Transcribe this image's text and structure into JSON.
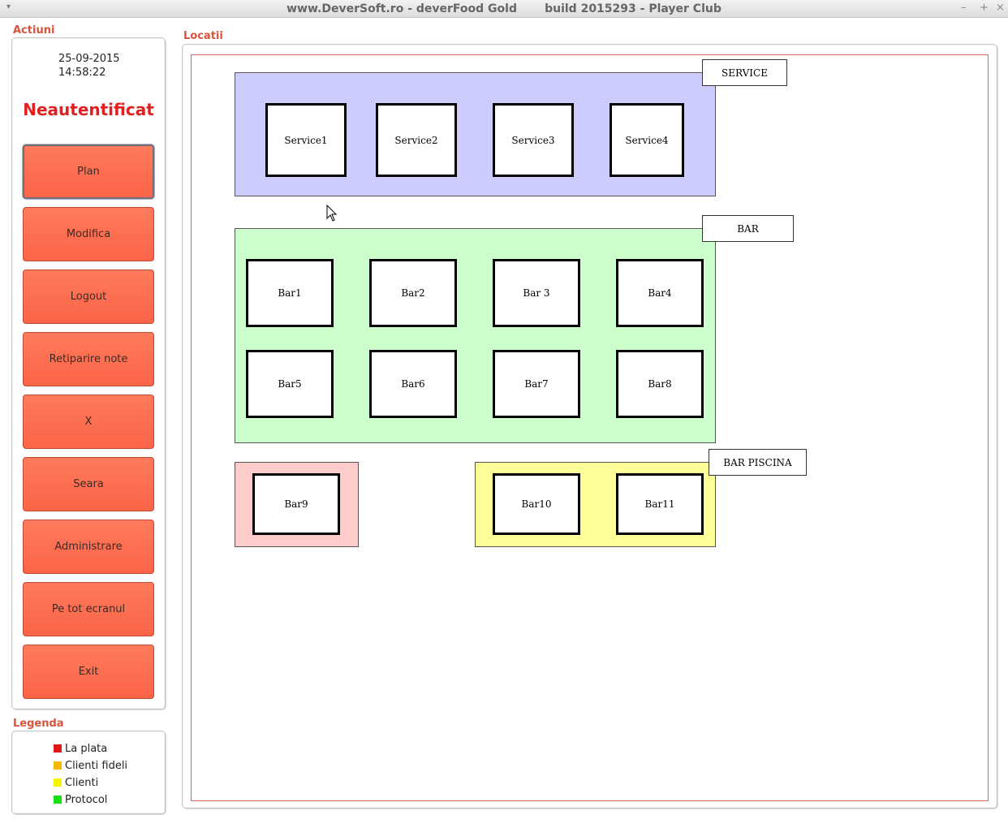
{
  "window": {
    "title": "www.DeverSoft.ro - deverFood Gold       build 2015293 - Player Club",
    "menu_glyph": "▾",
    "minimize_glyph": "–",
    "maximize_glyph": "+",
    "close_glyph": "×"
  },
  "actions": {
    "group_label": "Actiuni",
    "date": "25-09-2015",
    "time": "14:58:22",
    "auth_status": "Neautentificat",
    "buttons": [
      {
        "label": "Plan"
      },
      {
        "label": "Modifica"
      },
      {
        "label": "Logout"
      },
      {
        "label": "Retiparire note"
      },
      {
        "label": "X"
      },
      {
        "label": "Seara"
      },
      {
        "label": "Administrare"
      },
      {
        "label": "Pe tot ecranul"
      },
      {
        "label": "Exit"
      }
    ],
    "active_button": "Plan",
    "button_color": "#fb6447"
  },
  "legend": {
    "group_label": "Legenda",
    "items": [
      {
        "label": "La plata",
        "color": "#e01818"
      },
      {
        "label": "Clienti fideli",
        "color": "#f5b800"
      },
      {
        "label": "Clienti",
        "color": "#f5f500"
      },
      {
        "label": "Protocol",
        "color": "#18e018"
      }
    ]
  },
  "locations": {
    "group_label": "Locatii",
    "zones": [
      {
        "label": "SERVICE",
        "color": "#ccccff",
        "tables": [
          "Service1",
          "Service2",
          "Service3",
          "Service4"
        ]
      },
      {
        "label": "BAR",
        "color": "#ccffcc",
        "tables": [
          "Bar1",
          "Bar2",
          "Bar 3",
          "Bar4",
          "Bar5",
          "Bar6",
          "Bar7",
          "Bar8"
        ]
      },
      {
        "label": "",
        "color": "#ffcccc",
        "tables": [
          "Bar9"
        ]
      },
      {
        "label": "BAR PISCINA",
        "color": "#ffff99",
        "tables": [
          "Bar10",
          "Bar11"
        ]
      }
    ]
  }
}
